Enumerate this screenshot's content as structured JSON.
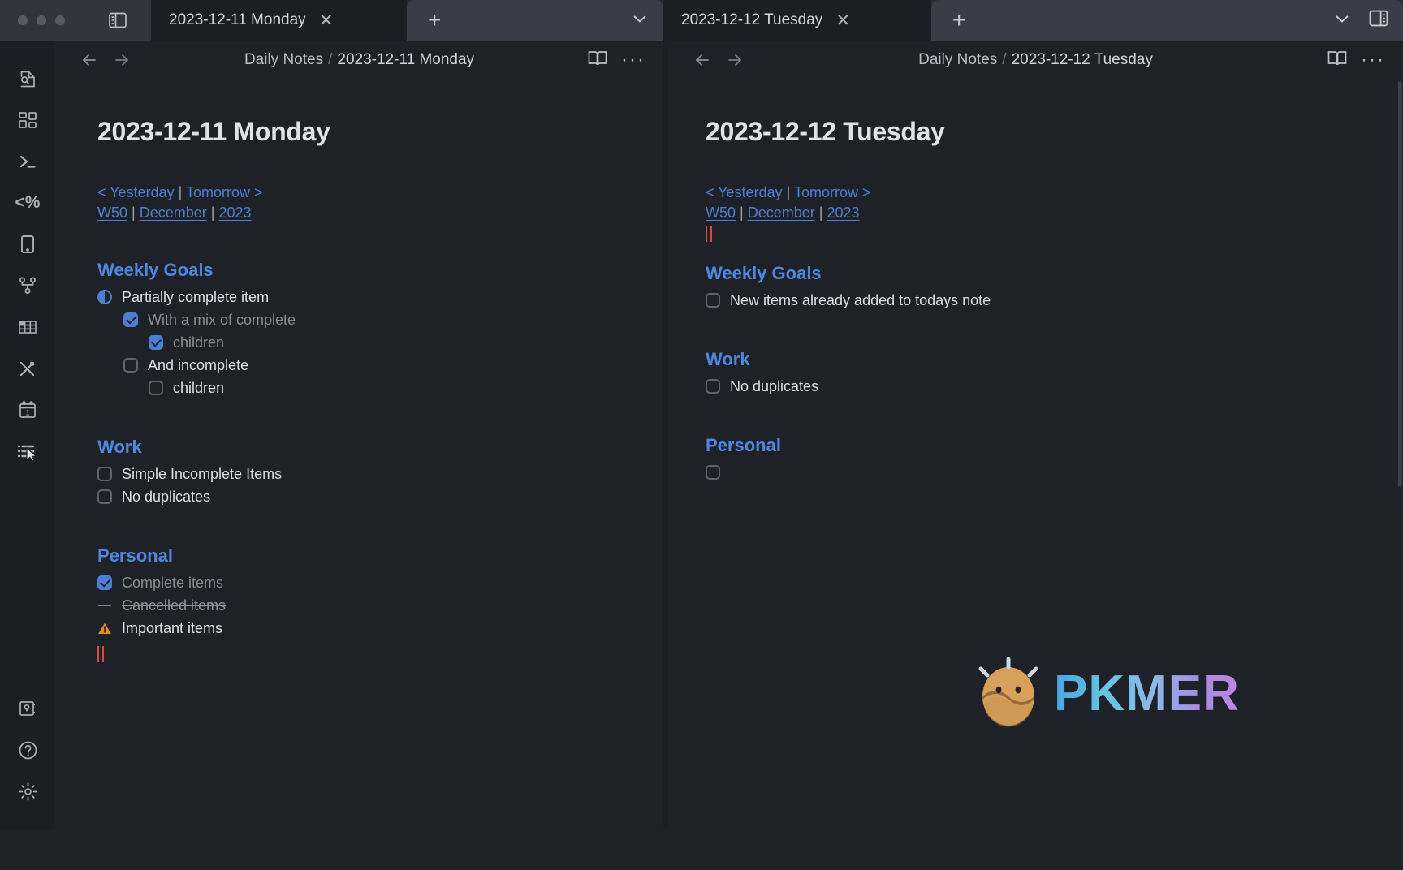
{
  "window": {
    "traffic_lights": [
      "close",
      "minimize",
      "maximize"
    ],
    "left_sidebar_toggle_icon": "sidebar-left-icon",
    "right_sidebar_toggle_icon": "sidebar-right-icon",
    "new_tab_label": "+",
    "tab_list_icon": "chevron-down-icon",
    "close_icon": "✕"
  },
  "tabs": [
    {
      "title": "2023-12-11 Monday",
      "active": true
    },
    {
      "title": "2023-12-12 Tuesday",
      "active": true
    }
  ],
  "ribbon": {
    "items": [
      {
        "name": "file-search-icon",
        "label": "Search in file"
      },
      {
        "name": "dashboard-grid-icon",
        "label": "Dashboard"
      },
      {
        "name": "terminal-icon",
        "label": "Terminal"
      },
      {
        "name": "templater-icon",
        "label": "<%"
      },
      {
        "name": "tablet-icon",
        "label": "Tablet"
      },
      {
        "name": "git-branch-icon",
        "label": "Git"
      },
      {
        "name": "table-icon",
        "label": "Table"
      },
      {
        "name": "excalidraw-icon",
        "label": "Excalidraw"
      },
      {
        "name": "calendar-icon",
        "label": "Calendar"
      },
      {
        "name": "task-list-icon",
        "label": "Tasks"
      }
    ],
    "bottom_items": [
      {
        "name": "vault-icon",
        "label": "Vault"
      },
      {
        "name": "help-icon",
        "label": "Help"
      },
      {
        "name": "settings-gear-icon",
        "label": "Settings"
      }
    ]
  },
  "panes": [
    {
      "header": {
        "back_icon": "arrow-left-icon",
        "forward_icon": "arrow-right-icon",
        "breadcrumb_parent": "Daily Notes",
        "breadcrumb_separator": "/",
        "breadcrumb_current": "2023-12-11 Monday",
        "reading_mode_icon": "book-open-icon",
        "more_options_icon": "more-options-icon",
        "more_options_label": "···"
      },
      "note": {
        "title": "2023-12-11 Monday",
        "nav_row_1": {
          "yesterday": "< Yesterday",
          "separator": "|",
          "tomorrow": "Tomorrow >"
        },
        "nav_row_2": {
          "week": "W50",
          "sep1": "|",
          "month": "December",
          "sep2": "|",
          "year": "2023"
        },
        "sections": [
          {
            "heading": "Weekly Goals",
            "tasks": [
              {
                "state": "partial",
                "text": "Partially complete item",
                "indent": 0
              },
              {
                "state": "done",
                "text": "With a mix of complete",
                "indent": 1
              },
              {
                "state": "done",
                "text": "children",
                "indent": 2
              },
              {
                "state": "todo",
                "text": "And incomplete",
                "indent": 1
              },
              {
                "state": "todo",
                "text": "children",
                "indent": 2
              }
            ]
          },
          {
            "heading": "Work",
            "tasks": [
              {
                "state": "todo",
                "text": "Simple Incomplete Items",
                "indent": 0
              },
              {
                "state": "todo",
                "text": "No duplicates",
                "indent": 0
              }
            ]
          },
          {
            "heading": "Personal",
            "tasks": [
              {
                "state": "done",
                "text": "Complete items",
                "indent": 0
              },
              {
                "state": "cancelled",
                "text": "Cancelled items",
                "indent": 0
              },
              {
                "state": "important",
                "text": "Important items",
                "indent": 0
              },
              {
                "state": "cursor",
                "text": "",
                "indent": 0
              }
            ]
          }
        ]
      }
    },
    {
      "header": {
        "back_icon": "arrow-left-icon",
        "forward_icon": "arrow-right-icon",
        "breadcrumb_parent": "Daily Notes",
        "breadcrumb_separator": "/",
        "breadcrumb_current": "2023-12-12 Tuesday",
        "reading_mode_icon": "book-open-icon",
        "more_options_icon": "more-options-icon",
        "more_options_label": "···"
      },
      "note": {
        "title": "2023-12-12 Tuesday",
        "nav_row_1": {
          "yesterday": "< Yesterday",
          "separator": "|",
          "tomorrow": "Tomorrow >"
        },
        "nav_row_2": {
          "week": "W50",
          "sep1": "|",
          "month": "December",
          "sep2": "|",
          "year": "2023"
        },
        "sections": [
          {
            "heading": "Weekly Goals",
            "tasks": [
              {
                "state": "todo",
                "text": "New items already added to todays note",
                "indent": 0
              }
            ]
          },
          {
            "heading": "Work",
            "tasks": [
              {
                "state": "todo",
                "text": "No duplicates",
                "indent": 0
              }
            ]
          },
          {
            "heading": "Personal",
            "tasks": [
              {
                "state": "todo",
                "text": "",
                "indent": 0
              }
            ]
          }
        ]
      }
    }
  ],
  "watermark": {
    "text": "PKMER",
    "logo": "pkmer-egg-logo"
  },
  "colors": {
    "accent_link": "#4b7fd1",
    "heading": "#4e87e0",
    "checkbox_done": "#4a7fd4",
    "cursor": "#d94a3d",
    "important": "#e08a2e",
    "background": "#1e2228",
    "chrome": "#2a2f37"
  }
}
